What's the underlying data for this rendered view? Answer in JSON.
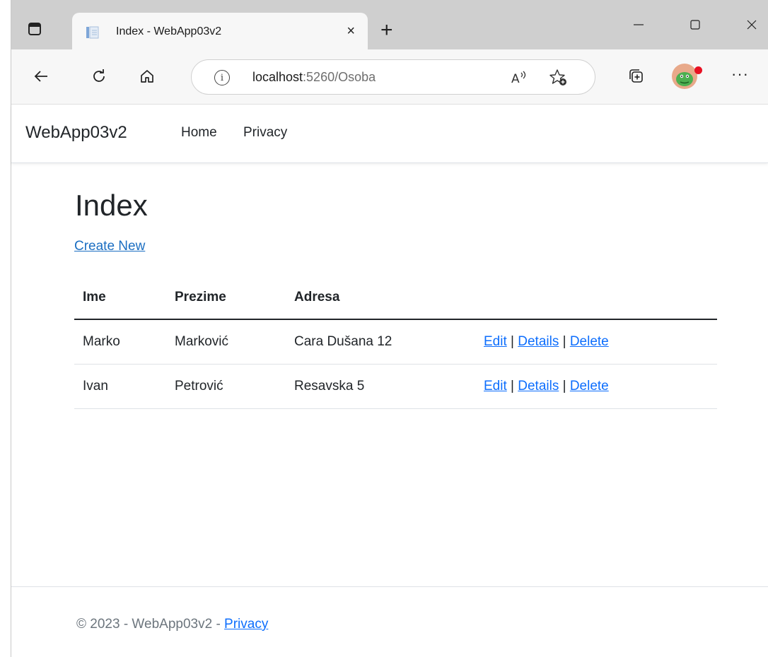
{
  "browser": {
    "tab": {
      "title": "Index - WebApp03v2",
      "close_glyph": "×"
    },
    "new_tab_glyph": "+",
    "window_controls": {
      "minimize": "—",
      "maximize": "☐",
      "close": "✕"
    },
    "address": {
      "host": "localhost",
      "rest": ":5260/Osoba"
    },
    "more_glyph": "···"
  },
  "navbar": {
    "brand": "WebApp03v2",
    "links": [
      "Home",
      "Privacy"
    ]
  },
  "main": {
    "heading": "Index",
    "create_link": "Create New",
    "table": {
      "headers": [
        "Ime",
        "Prezime",
        "Adresa"
      ],
      "rows": [
        {
          "ime": "Marko",
          "prezime": "Marković",
          "adresa": "Cara Dušana 12"
        },
        {
          "ime": "Ivan",
          "prezime": "Petrović",
          "adresa": "Resavska 5"
        }
      ],
      "actions": {
        "edit": "Edit",
        "details": "Details",
        "delete": "Delete",
        "separator": "|"
      }
    }
  },
  "footer": {
    "text": "© 2023 - WebApp03v2 - ",
    "link": "Privacy"
  },
  "colors": {
    "link": "#0d6efd",
    "tabbar": "#cfcfcf",
    "toolbar": "#f7f7f7",
    "notification_dot": "#e81123"
  },
  "icons": [
    "tab-actions-icon",
    "page-favicon-icon",
    "back-icon",
    "refresh-icon",
    "home-icon",
    "site-info-icon",
    "read-aloud-icon",
    "add-favorite-icon",
    "collections-icon",
    "profile-avatar-icon",
    "more-icon"
  ]
}
